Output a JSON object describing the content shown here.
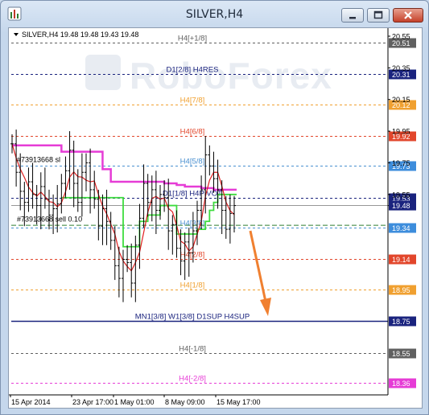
{
  "window": {
    "title": "SILVER,H4"
  },
  "symbol_info": "SILVER,H4  19.48 19.48 19.43 19.48",
  "watermark": "RoboForex",
  "arrow_color": "#f08030",
  "level_lines": [
    {
      "label": "H4[+1/8]",
      "price": 20.51,
      "color": "#606060",
      "tag_bg": "#606060",
      "show_tag": true
    },
    {
      "label": "D1[2/8] H4RES",
      "price": 20.31,
      "color": "#1a237e",
      "tag_bg": "#1a237e",
      "show_tag": true
    },
    {
      "label": "H4[7/8]",
      "price": 20.12,
      "color": "#f0a030",
      "tag_bg": "#f0a030",
      "show_tag": true
    },
    {
      "label": "H4[6/8]",
      "price": 19.92,
      "color": "#e2462b",
      "tag_bg": "#e2462b",
      "show_tag": true
    },
    {
      "label": "H4[5/8]",
      "price": 19.73,
      "color": "#4a90d0",
      "tag_bg": "#3d8ddc",
      "show_tag": true
    },
    {
      "label": "D1[1/8] H4PIVOT",
      "price": 19.53,
      "color": "#1a237e",
      "tag_bg": "#1a237e",
      "show_tag": true
    },
    {
      "label": "H4[3/8]",
      "price": 19.34,
      "color": "#4a90d0",
      "tag_bg": "#3d8ddc",
      "show_tag": true
    },
    {
      "label": "H4[2/8]",
      "price": 19.14,
      "color": "#e2462b",
      "tag_bg": "#e2462b",
      "show_tag": true
    },
    {
      "label": "H4[1/8]",
      "price": 18.95,
      "color": "#f0a030",
      "tag_bg": "#f0a030",
      "show_tag": true
    },
    {
      "label": "MN1[3/8] W1[3/8] D1SUP H4SUP",
      "price": 18.75,
      "color": "#1a237e",
      "tag_bg": "#1a237e",
      "show_tag": true
    },
    {
      "label": "H4[-1/8]",
      "price": 18.55,
      "color": "#606060",
      "tag_bg": "#606060",
      "show_tag": true
    },
    {
      "label": "H4[-2/8]",
      "price": 18.36,
      "color": "#e63cd6",
      "tag_bg": "#e63cd6",
      "show_tag": true
    }
  ],
  "price_axis_labels": [
    "20.55",
    "20.35",
    "20.15",
    "19.95",
    "19.75",
    "19.55",
    "19.48"
  ],
  "order_labels": [
    {
      "text": "#73913668 sl"
    },
    {
      "text": "#73913668 sell 0.10"
    }
  ],
  "chart_data": {
    "type": "line",
    "symbol": "SILVER",
    "timeframe": "H4",
    "x_labels": [
      "15 Apr 2014",
      "23 Apr 17:00",
      "1 May 01:00",
      "8 May 09:00",
      "15 May 17:00"
    ],
    "ylim": [
      18.3,
      20.6
    ],
    "close": [
      19.87,
      19.69,
      19.57,
      19.5,
      19.63,
      19.55,
      19.48,
      19.6,
      19.52,
      19.42,
      19.46,
      19.49,
      19.62,
      19.7,
      19.83,
      19.62,
      19.5,
      19.69,
      19.75,
      19.58,
      19.52,
      19.35,
      19.46,
      19.38,
      19.26,
      19.1,
      19.02,
      19.14,
      19.12,
      18.99,
      19.23,
      19.4,
      19.62,
      19.5,
      19.58,
      19.45,
      19.55,
      19.53,
      19.32,
      19.36,
      19.21,
      19.13,
      19.25,
      19.18,
      19.32,
      19.45,
      19.58,
      19.8,
      19.73,
      19.65,
      19.58,
      19.45,
      19.33,
      19.43,
      19.48
    ],
    "upper_band": [
      19.86,
      19.86,
      19.86,
      19.86,
      19.86,
      19.86,
      19.86,
      19.86,
      19.86,
      19.86,
      19.86,
      19.86,
      19.82,
      19.82,
      19.82,
      19.82,
      19.82,
      19.82,
      19.82,
      19.82,
      19.82,
      19.82,
      19.71,
      19.71,
      19.63,
      19.63,
      19.63,
      19.63,
      19.63,
      19.63,
      19.63,
      19.63,
      19.63,
      19.63,
      19.63,
      19.63,
      19.63,
      19.62,
      19.62,
      19.62,
      19.61,
      19.61,
      19.6,
      19.6,
      19.6,
      19.6,
      19.59,
      19.59,
      19.59,
      19.58,
      19.58,
      19.58,
      19.58,
      19.58,
      19.58
    ],
    "lower_band": [
      19.53,
      19.53,
      19.53,
      19.53,
      19.53,
      19.53,
      19.53,
      19.53,
      19.53,
      19.53,
      19.53,
      19.53,
      19.53,
      19.53,
      19.53,
      19.53,
      19.53,
      19.53,
      19.53,
      19.53,
      19.53,
      19.53,
      19.53,
      19.53,
      19.53,
      19.53,
      19.53,
      19.22,
      19.22,
      19.22,
      19.22,
      19.38,
      19.38,
      19.42,
      19.42,
      19.42,
      19.48,
      19.48,
      19.48,
      19.48,
      19.3,
      19.3,
      19.3,
      19.3,
      19.3,
      19.33,
      19.33,
      19.38,
      19.45,
      19.5,
      19.55,
      19.55,
      19.55,
      19.55,
      19.55
    ],
    "bands_start_index": [
      0,
      12
    ],
    "forecast_arrow": "down"
  }
}
